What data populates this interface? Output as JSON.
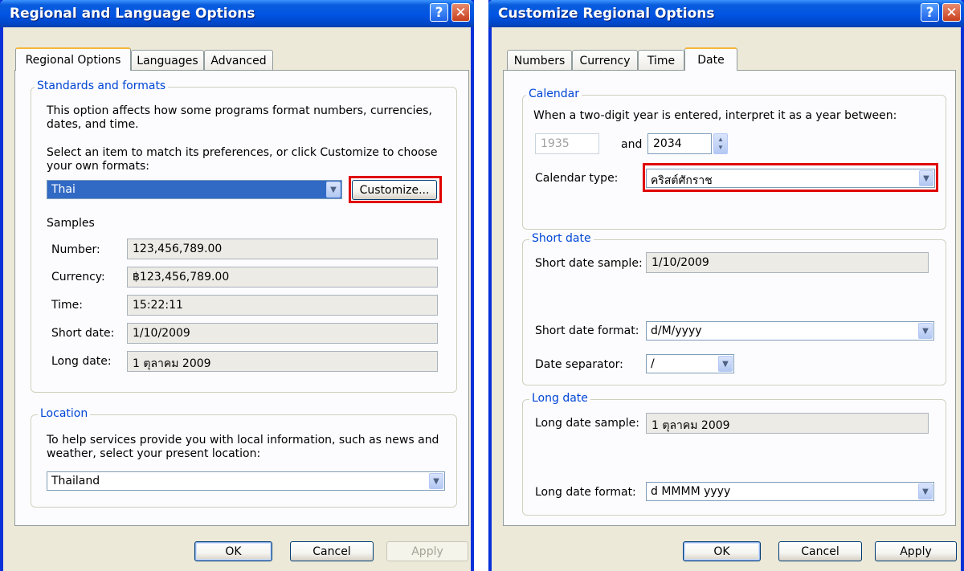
{
  "left_dialog": {
    "title": "Regional and Language Options",
    "tabs": [
      "Regional Options",
      "Languages",
      "Advanced"
    ],
    "standards": {
      "group_label": "Standards and formats",
      "description": "This option affects how some programs format numbers, currencies, dates, and time.",
      "select_prompt": "Select an item to match its preferences, or click Customize to choose your own formats:",
      "selected_locale": "Thai",
      "customize_label": "Customize...",
      "samples_label": "Samples",
      "samples": [
        {
          "label": "Number:",
          "value": "123,456,789.00"
        },
        {
          "label": "Currency:",
          "value": "฿123,456,789.00"
        },
        {
          "label": "Time:",
          "value": "15:22:11"
        },
        {
          "label": "Short date:",
          "value": "1/10/2009"
        },
        {
          "label": "Long date:",
          "value": "1 ตุลาคม 2009"
        }
      ]
    },
    "location": {
      "group_label": "Location",
      "description": "To help services provide you with local information, such as news and weather, select your present location:",
      "selected": "Thailand"
    },
    "buttons": {
      "ok": "OK",
      "cancel": "Cancel",
      "apply": "Apply"
    }
  },
  "right_dialog": {
    "title": "Customize Regional Options",
    "tabs": [
      "Numbers",
      "Currency",
      "Time",
      "Date"
    ],
    "calendar": {
      "group_label": "Calendar",
      "description": "When a two-digit year is entered, interpret it as a year between:",
      "year_from": "1935",
      "and_label": "and",
      "year_to": "2034",
      "type_label": "Calendar type:",
      "type_value": "คริสต์ศักราช"
    },
    "short_date": {
      "group_label": "Short date",
      "sample_label": "Short date sample:",
      "sample_value": "1/10/2009",
      "format_label": "Short date format:",
      "format_value": "d/M/yyyy",
      "separator_label": "Date separator:",
      "separator_value": "/"
    },
    "long_date": {
      "group_label": "Long date",
      "sample_label": "Long date sample:",
      "sample_value": "1 ตุลาคม 2009",
      "format_label": "Long date format:",
      "format_value": "d MMMM yyyy"
    },
    "buttons": {
      "ok": "OK",
      "cancel": "Cancel",
      "apply": "Apply"
    }
  },
  "icons": {
    "help": "?",
    "close": "✕",
    "dropdown": "▼",
    "spin_up": "▲",
    "spin_down": "▼"
  },
  "colors": {
    "highlight": "#e00000",
    "title_bar": "#0054e3",
    "group_label": "#0046d5"
  }
}
